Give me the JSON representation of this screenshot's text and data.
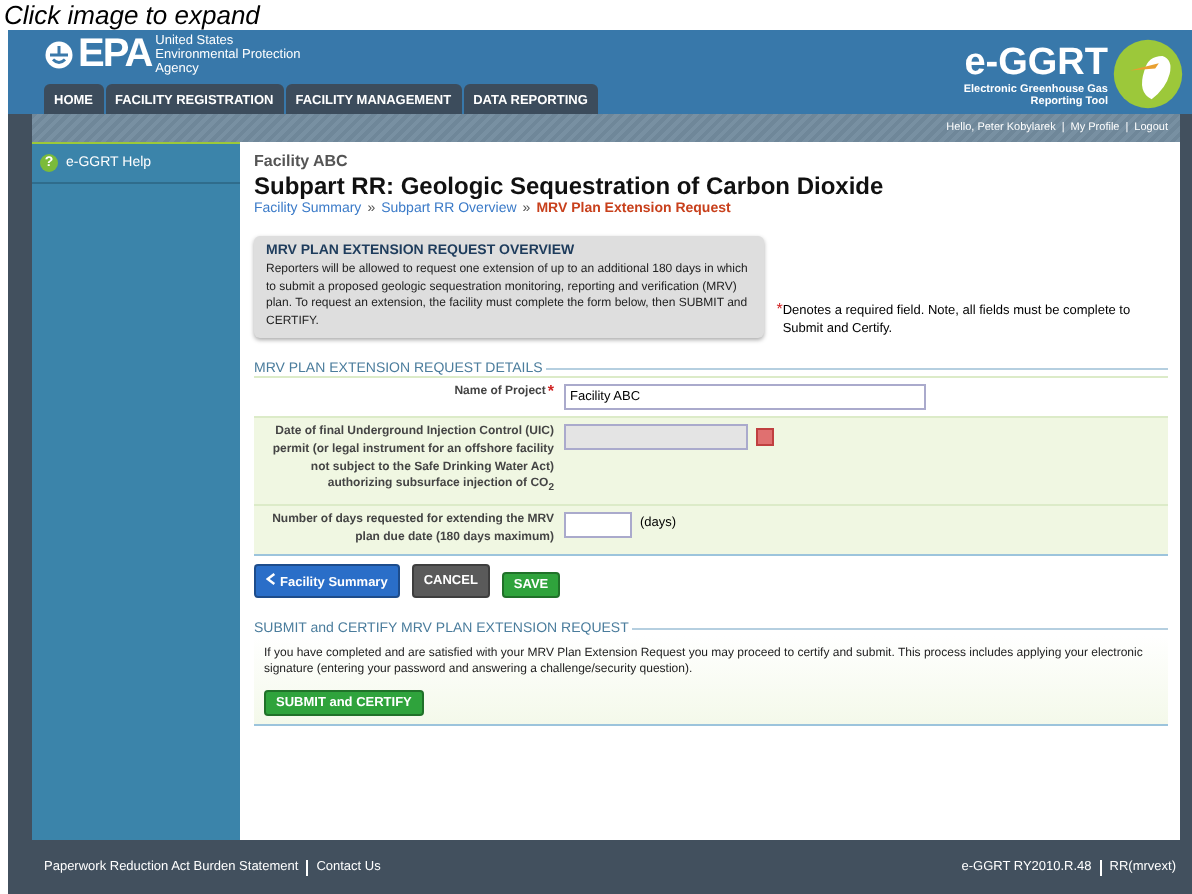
{
  "caption": "Click image to expand",
  "header": {
    "agency_mark": "EPA",
    "agency_lines": [
      "United States",
      "Environmental Protection",
      "Agency"
    ],
    "app_name": "e-GGRT",
    "app_subtitle": [
      "Electronic Greenhouse Gas",
      "Reporting Tool"
    ]
  },
  "tabs": [
    {
      "label": "HOME",
      "selected": false
    },
    {
      "label": "FACILITY REGISTRATION",
      "selected": false
    },
    {
      "label": "FACILITY MANAGEMENT",
      "selected": false
    },
    {
      "label": "DATA REPORTING",
      "selected": false
    }
  ],
  "user_bar": {
    "items": [
      "Hello, Peter Kobylarek",
      "My Profile",
      "Logout"
    ],
    "separator": "|"
  },
  "sidebar": {
    "help_icon": "?",
    "help_link": "e-GGRT Help"
  },
  "required_mark": "*",
  "breadcrumb_separator": "»",
  "main": {
    "facility": "Facility ABC",
    "title": "Subpart RR: Geologic Sequestration of Carbon Dioxide",
    "breadcrumb": [
      {
        "label": "Facility Summary",
        "current": false
      },
      {
        "label": "Subpart RR Overview",
        "current": false
      },
      {
        "label": "MRV Plan Extension Request",
        "current": true
      }
    ],
    "overview": {
      "title": "MRV PLAN EXTENSION REQUEST OVERVIEW",
      "text": "Reporters will be allowed to request one extension of up to an additional 180 days in which to submit a proposed geologic sequestration monitoring, reporting and verification (MRV) plan. To request an extension, the facility must complete the form below, then SUBMIT and CERTIFY."
    },
    "required_note": "Denotes a required field. Note, all fields must be complete to Submit and Certify.",
    "details": {
      "legend": "MRV PLAN EXTENSION REQUEST DETAILS",
      "fields": [
        {
          "kind": "text",
          "label": "Name of Project",
          "required": true,
          "value": "Facility ABC"
        },
        {
          "kind": "date",
          "label": "Date of final Underground Injection Control (UIC) permit (or legal instrument for an offshore facility not subject to the Safe Drinking Water Act) authorizing subsurface injection of CO$_{2}$",
          "required": false,
          "disabled": true
        },
        {
          "kind": "number",
          "label": "Number of days requested for extending the MRV plan due date (180 days maximum)",
          "required": false,
          "unit": "(days)"
        }
      ]
    },
    "buttons": [
      {
        "kind": "back",
        "label": "Facility Summary"
      },
      {
        "kind": "cancel",
        "label": "CANCEL"
      },
      {
        "kind": "save",
        "label": "SAVE"
      }
    ],
    "submit": {
      "legend": "SUBMIT and CERTIFY MRV PLAN EXTENSION REQUEST",
      "text": "If you have completed and are satisfied with your MRV Plan Extension Request you may proceed to certify and submit. This process includes applying your electronic signature (entering your password and answering a challenge/security question).",
      "button": "SUBMIT and CERTIFY"
    }
  },
  "footer": {
    "links": [
      "Paperwork Reduction Act Burden Statement",
      "Contact Us"
    ],
    "info": [
      "e-GGRT RY2010.R.48",
      "RR(mrvext)"
    ]
  }
}
